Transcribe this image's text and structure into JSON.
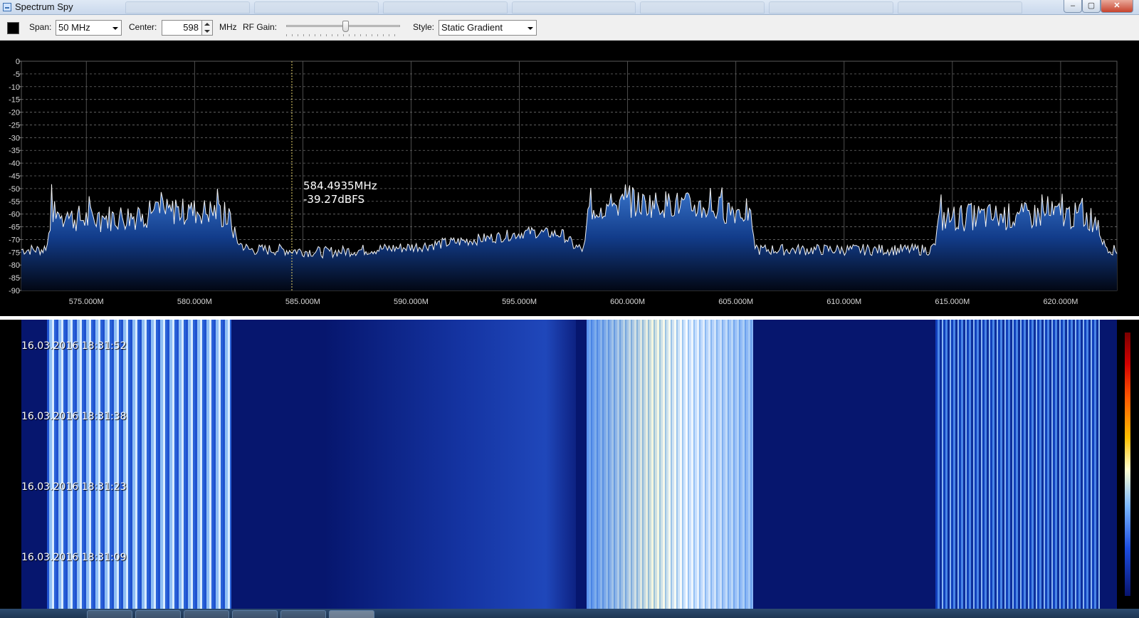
{
  "window": {
    "title": "Spectrum Spy",
    "minimize": "–",
    "maximize": "▢",
    "close": "✕"
  },
  "toolbar": {
    "span_label": "Span:",
    "span_value": "50 MHz",
    "center_label": "Center:",
    "center_value": "598",
    "center_unit": "MHz",
    "rf_gain_label": "RF Gain:",
    "rf_gain_level": 0.52,
    "style_label": "Style:",
    "style_value": "Static Gradient",
    "trace_color": "#000000"
  },
  "chart_data": {
    "type": "line",
    "title": "",
    "xlabel": "",
    "ylabel": "",
    "xlim": [
      572.0,
      622.6
    ],
    "ylim": [
      -90,
      0
    ],
    "grid": true,
    "y_ticks": [
      "0",
      "-5",
      "-10",
      "-15",
      "-20",
      "-25",
      "-30",
      "-35",
      "-40",
      "-45",
      "-50",
      "-55",
      "-60",
      "-65",
      "-70",
      "-75",
      "-80",
      "-85",
      "-90"
    ],
    "x_ticks": [
      {
        "value": 575.0,
        "label": "575.000M"
      },
      {
        "value": 580.0,
        "label": "580.000M"
      },
      {
        "value": 585.0,
        "label": "585.000M"
      },
      {
        "value": 590.0,
        "label": "590.000M"
      },
      {
        "value": 595.0,
        "label": "595.000M"
      },
      {
        "value": 600.0,
        "label": "600.000M"
      },
      {
        "value": 605.0,
        "label": "605.000M"
      },
      {
        "value": 610.0,
        "label": "610.000M"
      },
      {
        "value": 615.0,
        "label": "615.000M"
      },
      {
        "value": 620.0,
        "label": "620.000M"
      }
    ],
    "series": [
      {
        "x": [
          572.0,
          573.0,
          573.2,
          573.4,
          573.6,
          575.0,
          577.0,
          579.0,
          581.0,
          581.7,
          582.0,
          582.5,
          584.0,
          586.0,
          588.0,
          590.0,
          592.0,
          594.0,
          595.5,
          597.0,
          597.6,
          598.0,
          598.2,
          600.0,
          602.0,
          604.0,
          605.6,
          605.8,
          606.0,
          608.0,
          610.0,
          612.0,
          614.0,
          614.2,
          614.4,
          616.0,
          618.0,
          620.0,
          621.6,
          622.0,
          622.6
        ],
        "y": [
          -74,
          -74,
          -72,
          -58,
          -61,
          -62,
          -61,
          -59,
          -59,
          -63,
          -71,
          -74,
          -74,
          -75,
          -74,
          -73,
          -71,
          -69,
          -67,
          -68,
          -73,
          -74,
          -58,
          -56,
          -56,
          -58,
          -59,
          -70,
          -74,
          -74,
          -74,
          -74,
          -74,
          -72,
          -62,
          -61,
          -61,
          -60,
          -62,
          -72,
          -75
        ]
      }
    ],
    "cursor": {
      "frequency": "584.4935MHz",
      "level": "-39.27dBFS",
      "x": 584.4935
    }
  },
  "waterfall": {
    "timestamps": [
      "16.03.2016 18:31:52",
      "16.03.2016 18:31:38",
      "16.03.2016 18:31:23",
      "16.03.2016 18:31:09"
    ],
    "bands": [
      {
        "name": "waterfall-band-1",
        "from": 573.2,
        "to": 581.7,
        "style": "stripe-strong"
      },
      {
        "name": "waterfall-band-2",
        "from": 586.0,
        "to": 597.6,
        "style": "haze"
      },
      {
        "name": "waterfall-band-3",
        "from": 598.1,
        "to": 605.8,
        "style": "hot"
      },
      {
        "name": "waterfall-band-4",
        "from": 614.2,
        "to": 621.8,
        "style": "stripe-dark"
      }
    ]
  }
}
